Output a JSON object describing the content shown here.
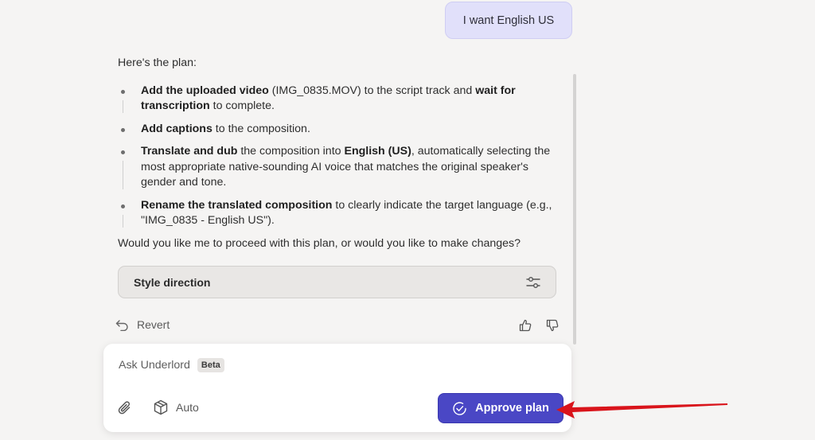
{
  "user_message": "I want English US",
  "assistant": {
    "intro": "Here's the plan:",
    "plan": [
      {
        "parts": [
          {
            "b": true,
            "t": "Add the uploaded video"
          },
          {
            "b": false,
            "t": " (IMG_0835.MOV) to the script track and "
          },
          {
            "b": true,
            "t": "wait for transcription"
          },
          {
            "b": false,
            "t": " to complete."
          }
        ]
      },
      {
        "parts": [
          {
            "b": true,
            "t": "Add captions"
          },
          {
            "b": false,
            "t": " to the composition."
          }
        ]
      },
      {
        "parts": [
          {
            "b": true,
            "t": "Translate and dub"
          },
          {
            "b": false,
            "t": " the composition into "
          },
          {
            "b": true,
            "t": "English (US)"
          },
          {
            "b": false,
            "t": ", automatically selecting the most appropriate native-sounding AI voice that matches the original speaker's gender and tone."
          }
        ]
      },
      {
        "parts": [
          {
            "b": true,
            "t": "Rename the translated composition"
          },
          {
            "b": false,
            "t": " to clearly indicate the target language (e.g., \"IMG_0835 - English US\")."
          }
        ]
      }
    ],
    "question": "Would you like me to proceed with this plan, or would you like to make changes?"
  },
  "style_direction": {
    "label": "Style direction",
    "icon": "sliders-icon"
  },
  "actions": {
    "revert_label": "Revert",
    "thumbs_up_icon": "thumbs-up-icon",
    "thumbs_down_icon": "thumbs-down-icon"
  },
  "composer": {
    "placeholder": "Ask Underlord",
    "badge": "Beta",
    "mode_label": "Auto",
    "approve_label": "Approve plan"
  },
  "colors": {
    "accent": "#4a47c5",
    "user_bubble": "#e1e0fa",
    "annotation_arrow": "#d9141b"
  }
}
